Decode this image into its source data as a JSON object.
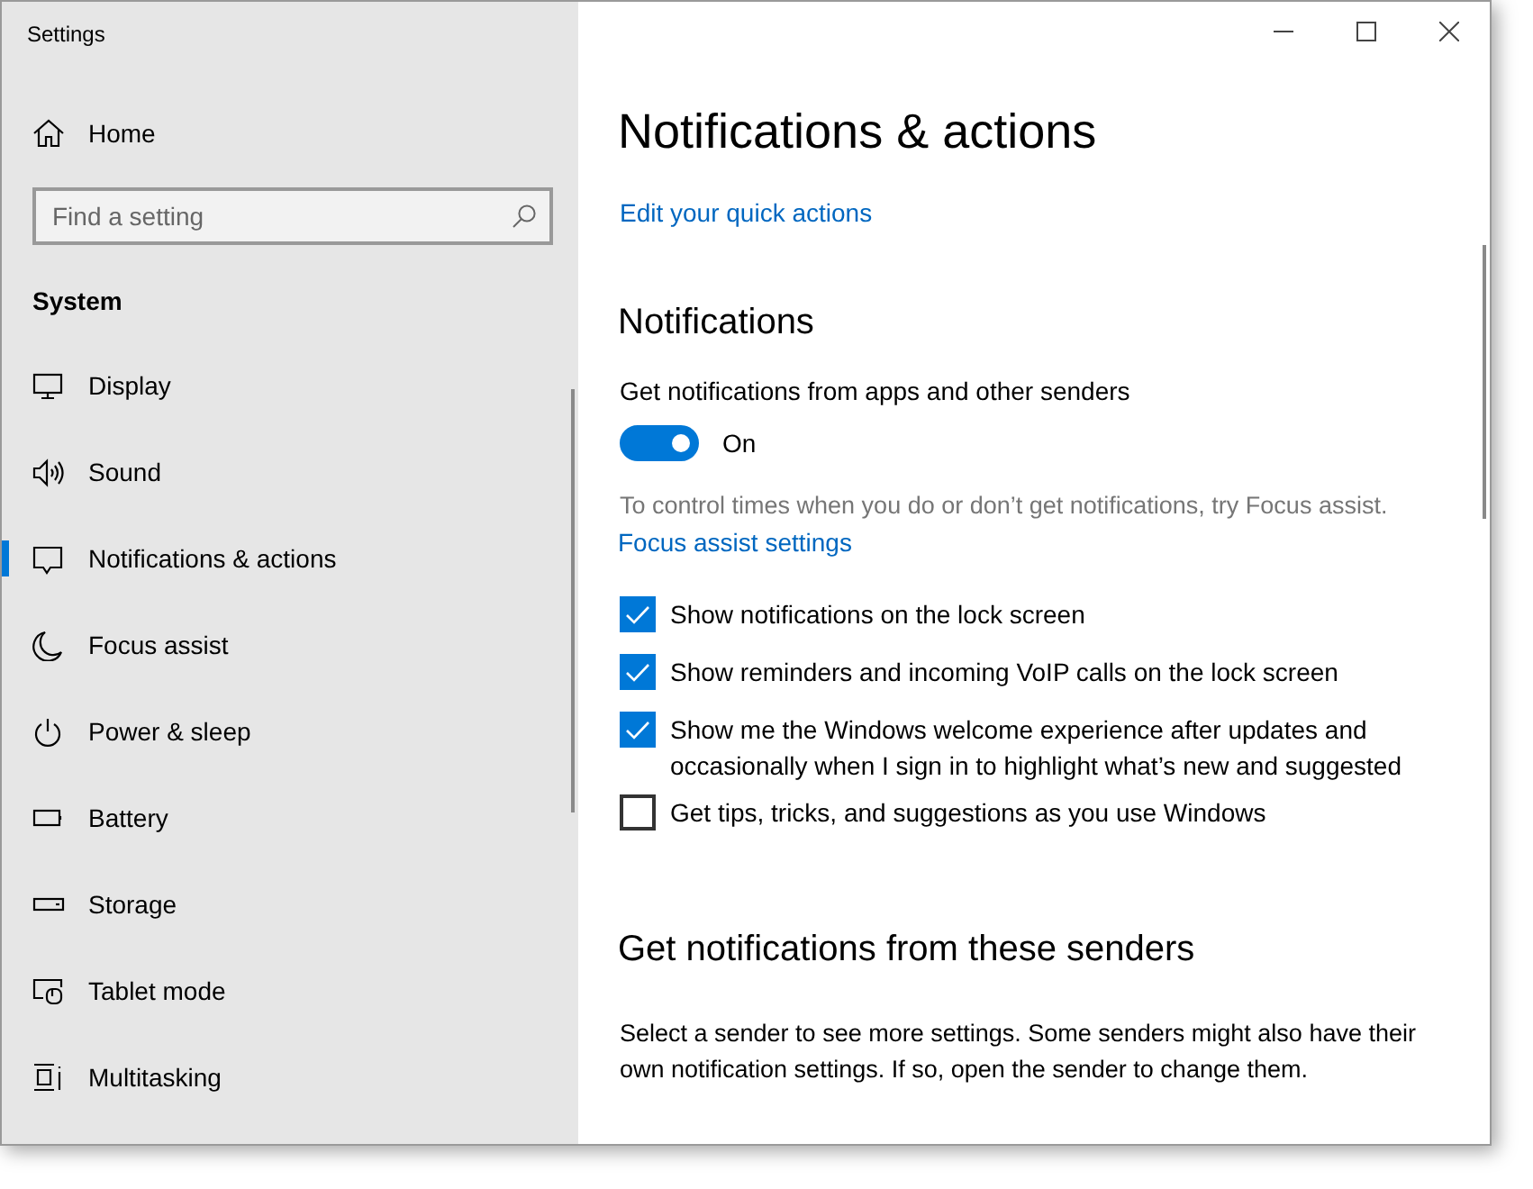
{
  "window": {
    "title": "Settings"
  },
  "sidebar": {
    "home": "Home",
    "search": {
      "placeholder": "Find a setting"
    },
    "section": "System",
    "items": [
      {
        "label": "Display",
        "selected": false
      },
      {
        "label": "Sound",
        "selected": false
      },
      {
        "label": "Notifications & actions",
        "selected": true
      },
      {
        "label": "Focus assist",
        "selected": false
      },
      {
        "label": "Power & sleep",
        "selected": false
      },
      {
        "label": "Battery",
        "selected": false
      },
      {
        "label": "Storage",
        "selected": false
      },
      {
        "label": "Tablet mode",
        "selected": false
      },
      {
        "label": "Multitasking",
        "selected": false
      }
    ]
  },
  "content": {
    "title": "Notifications & actions",
    "quick_actions_link": "Edit your quick actions",
    "notifications": {
      "heading": "Notifications",
      "toggle": {
        "label": "Get notifications from apps and other senders",
        "on": true,
        "state_text": "On"
      },
      "hint": "To control times when you do or don’t get notifications, try Focus assist.",
      "hint_link": "Focus assist settings",
      "checkboxes": [
        {
          "label": "Show notifications on the lock screen",
          "checked": true
        },
        {
          "label": "Show reminders and incoming VoIP calls on the lock screen",
          "checked": true
        },
        {
          "label": "Show me the Windows welcome experience after updates and occasionally when I sign in to highlight what’s new and suggested",
          "checked": true
        },
        {
          "label": "Get tips, tricks, and suggestions as you use Windows",
          "checked": false
        }
      ]
    },
    "senders": {
      "heading": "Get notifications from these senders",
      "description": "Select a sender to see more settings. Some senders might also have their own notification settings. If so, open the sender to change them."
    }
  }
}
